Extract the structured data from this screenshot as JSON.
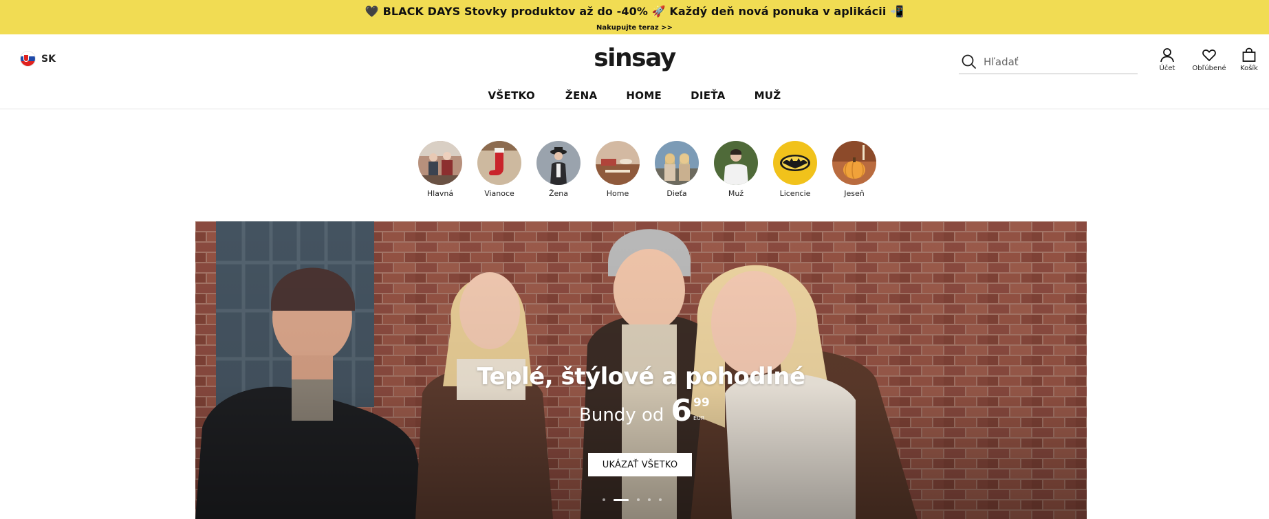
{
  "promo": {
    "headline": "🖤 BLACK DAYS Stovky produktov až do -40% 🚀 Každý deň nová ponuka v aplikácii 📲",
    "link": "Nakupujte teraz >>"
  },
  "header": {
    "language": "SK",
    "logo": "sinsay",
    "search_placeholder": "Hľadať",
    "actions": {
      "account": "Účet",
      "favorites": "Obľúbené",
      "cart": "Košík"
    },
    "nav": [
      "VŠETKO",
      "ŽENA",
      "HOME",
      "DIEŤA",
      "MUŽ"
    ]
  },
  "categories": [
    "Hlavná",
    "Vianoce",
    "Žena",
    "Home",
    "Dieťa",
    "Muž",
    "Licencie",
    "Jeseň"
  ],
  "hero": {
    "title": "Teplé, štýlové a pohodlné",
    "price_prefix": "Bundy od",
    "price_int": "6",
    "price_dec": "99",
    "currency": "EUR",
    "button": "UKÁZAŤ VŠETKO",
    "slides": 5,
    "active_slide": 2
  },
  "colors": {
    "promo_bg": "#f1dc53",
    "text": "#111111",
    "brick": "#8a4a3f"
  }
}
